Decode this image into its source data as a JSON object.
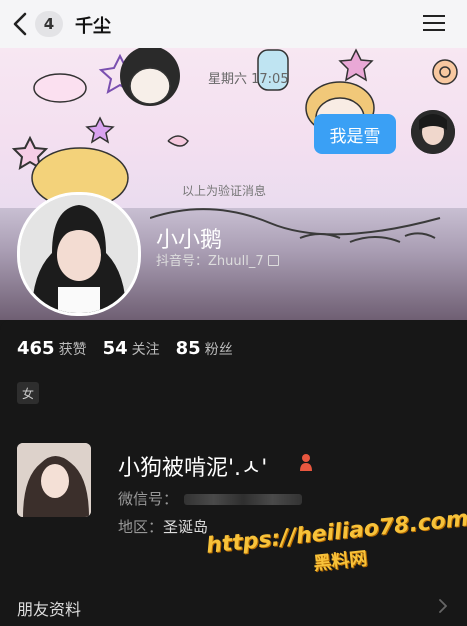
{
  "header": {
    "badge": "4",
    "title": "千尘"
  },
  "chat": {
    "timestamp": "星期六 17:05",
    "bubble_text": "我是雪",
    "verify_notice": "以上为验证消息"
  },
  "profile": {
    "nickname": "小小鹅",
    "douyin_id": "抖音号：Zhuull_7",
    "likes_num": "465",
    "likes_label": "获赞",
    "follow_num": "54",
    "follow_label": "关注",
    "fans_num": "85",
    "fans_label": "粉丝",
    "gender": "女"
  },
  "friend": {
    "name": "小狗被啃泥'.ㅅ'",
    "wechat_label": "微信号：",
    "region_label": "地区：",
    "region_value": "圣诞岛"
  },
  "watermark": {
    "url": "https://heiliao78.com",
    "site": "黑料网"
  },
  "footer": {
    "section_label": "朋友资料"
  }
}
